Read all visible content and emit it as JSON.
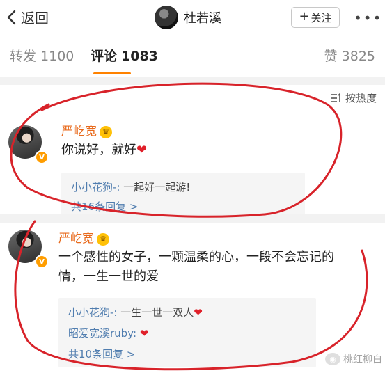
{
  "nav": {
    "back_label": "返回",
    "profile_name": "杜若溪",
    "follow_label": "关注",
    "more_label": "•••"
  },
  "tabs": {
    "repost": {
      "label": "转发",
      "count": "1100"
    },
    "comment": {
      "label": "评论",
      "count": "1083"
    },
    "like": {
      "label": "赞",
      "count": "3825"
    }
  },
  "sort_label": "按热度",
  "comments": [
    {
      "user": "严屹宽",
      "text": "你说好，就好",
      "heart": "❤",
      "replies": [
        {
          "user": "小小花狗-:",
          "text": " 一起好一起游!"
        }
      ],
      "more": "共16条回复 >"
    },
    {
      "user": "严屹宽",
      "text_line1": "一个感性的女子，一颗温柔的心，一段不会忘记的",
      "text_line2": "情，一生一世的爱",
      "replies": [
        {
          "user": "小小花狗-:",
          "text": " 一生一世一双人",
          "heart": "❤"
        },
        {
          "user": "昭爱宽溪ruby:",
          "text": " ",
          "heart": "❤"
        }
      ],
      "more": "共10条回复 >"
    }
  ],
  "watermark": "桃红柳白",
  "colors": {
    "accent": "#ff8200",
    "username": "#e86a1c",
    "reply_link": "#507daf",
    "annotation_ring": "#d8232a",
    "heart": "#e0202a"
  }
}
